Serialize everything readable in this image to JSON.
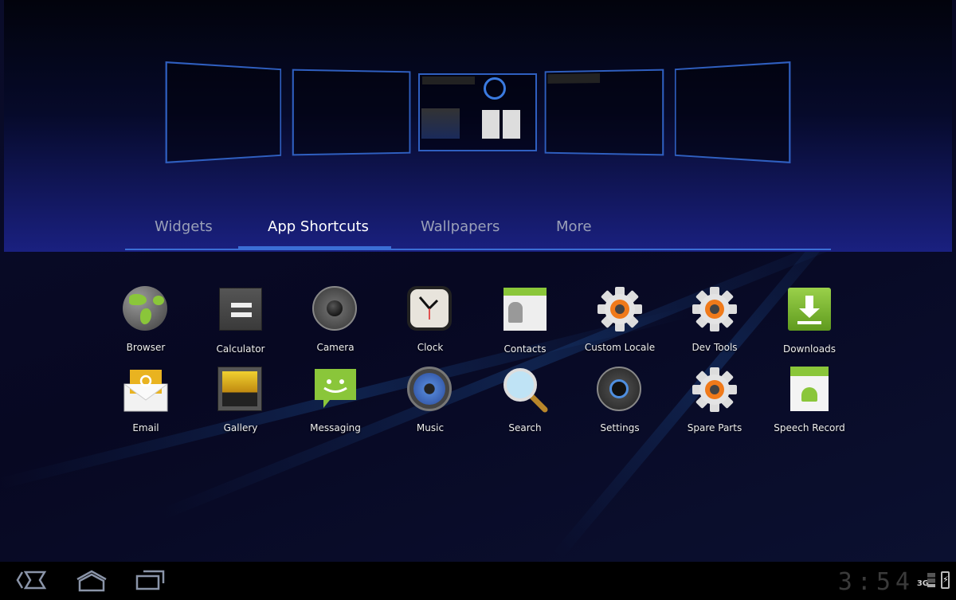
{
  "tabs": [
    {
      "label": "Widgets",
      "active": false
    },
    {
      "label": "App Shortcuts",
      "active": true
    },
    {
      "label": "Wallpapers",
      "active": false
    },
    {
      "label": "More",
      "active": false
    }
  ],
  "apps": [
    {
      "label": "Browser",
      "icon": "globe-icon"
    },
    {
      "label": "Calculator",
      "icon": "calculator-icon"
    },
    {
      "label": "Camera",
      "icon": "camera-icon"
    },
    {
      "label": "Clock",
      "icon": "clock-icon"
    },
    {
      "label": "Contacts",
      "icon": "contacts-icon"
    },
    {
      "label": "Custom Locale",
      "icon": "gear-icon"
    },
    {
      "label": "Dev Tools",
      "icon": "gear-icon"
    },
    {
      "label": "Downloads",
      "icon": "download-icon"
    },
    {
      "label": "Email",
      "icon": "email-icon"
    },
    {
      "label": "Gallery",
      "icon": "gallery-icon"
    },
    {
      "label": "Messaging",
      "icon": "messaging-icon"
    },
    {
      "label": "Music",
      "icon": "music-icon"
    },
    {
      "label": "Search",
      "icon": "magnifier-icon"
    },
    {
      "label": "Settings",
      "icon": "settings-icon"
    },
    {
      "label": "Spare Parts",
      "icon": "gear-icon"
    },
    {
      "label": "Speech Record",
      "icon": "android-icon"
    }
  ],
  "status": {
    "time": "3:54",
    "network": "3G"
  },
  "colors": {
    "accent": "#3b6fd6"
  }
}
